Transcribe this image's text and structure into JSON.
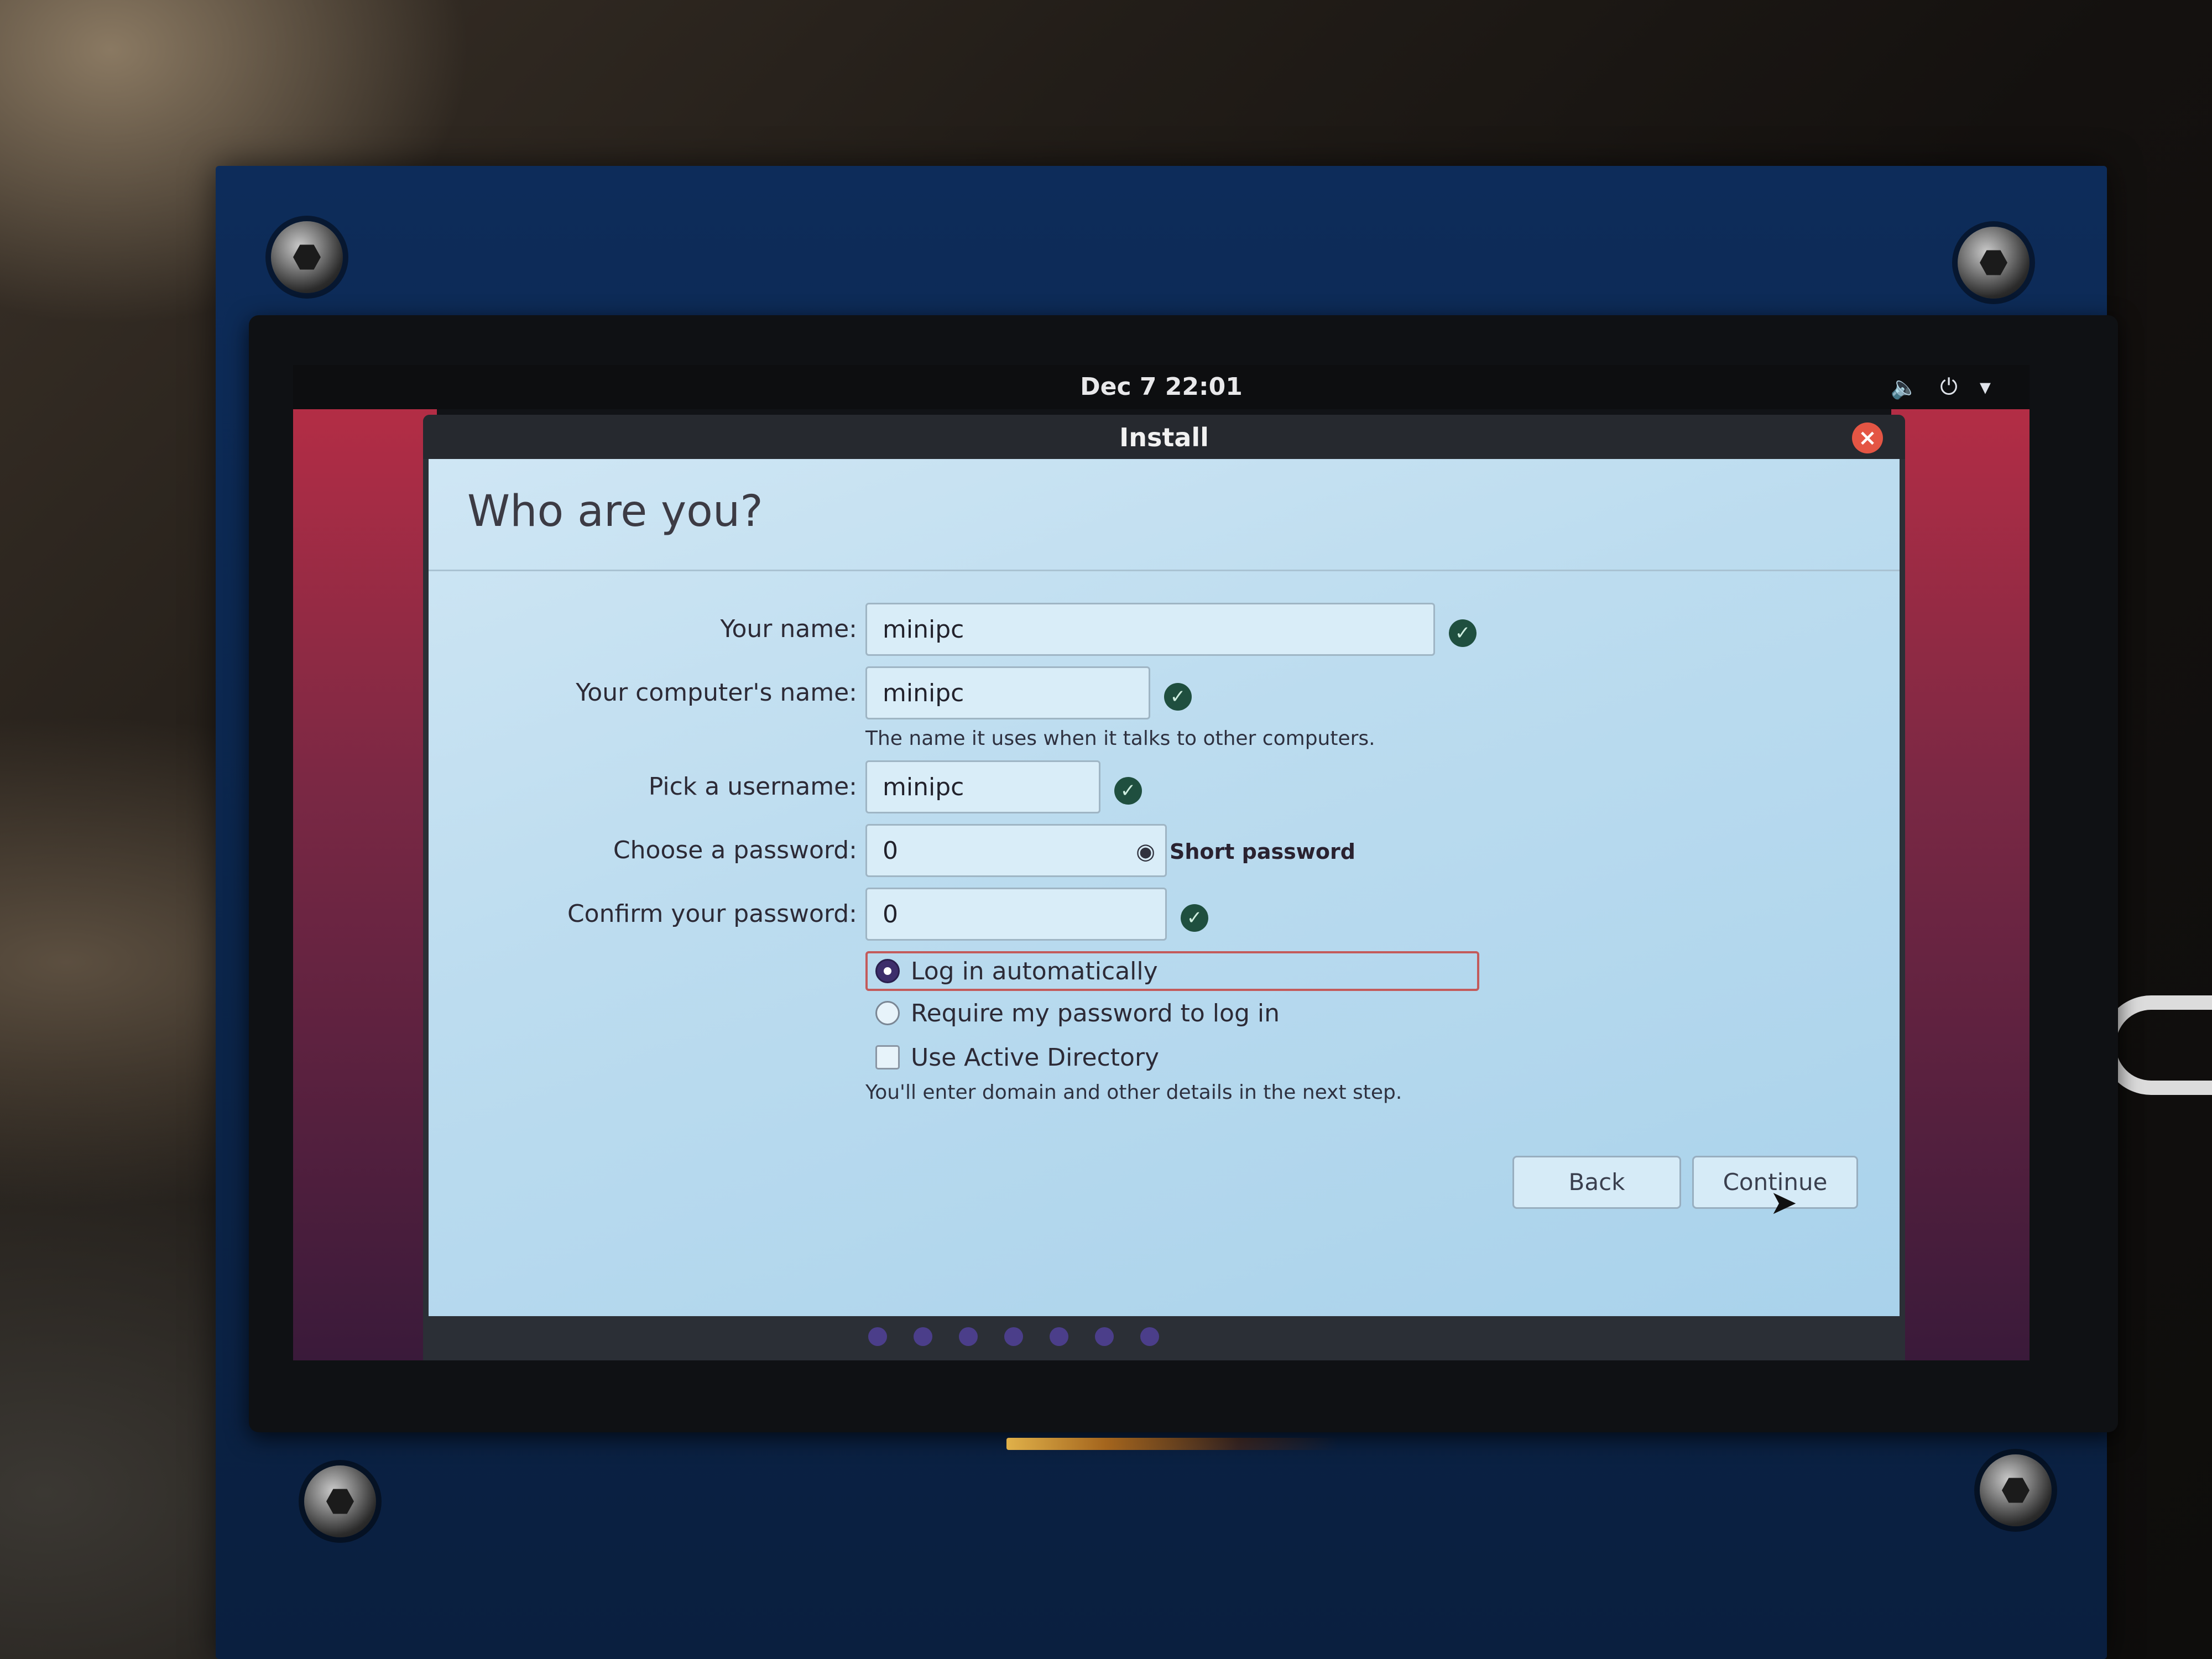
{
  "topbar": {
    "clock": "Dec 7  22:01",
    "icons": [
      "volume-icon",
      "power-icon",
      "chevron-down-icon"
    ]
  },
  "window": {
    "title": "Install",
    "close_icon": "close-icon"
  },
  "page": {
    "heading": "Who are you?"
  },
  "form": {
    "name": {
      "label": "Your name:",
      "value": "minipc"
    },
    "computer_name": {
      "label": "Your computer's name:",
      "value": "minipc",
      "hint": "The name it uses when it talks to other computers."
    },
    "username": {
      "label": "Pick a username:",
      "value": "minipc"
    },
    "password": {
      "label": "Choose a password:",
      "value": "0",
      "strength": "Short password"
    },
    "confirm_password": {
      "label": "Confirm your password:",
      "value": "0"
    },
    "login_options": [
      {
        "label": "Log in automatically",
        "selected": true
      },
      {
        "label": "Require my password to log in",
        "selected": false
      }
    ],
    "active_directory": {
      "label": "Use Active Directory",
      "checked": false,
      "hint": "You'll enter domain and other details in the next step."
    }
  },
  "buttons": {
    "back": "Back",
    "continue": "Continue"
  },
  "progress": {
    "steps_total": 7
  },
  "colors": {
    "accent": "#4b3e8a",
    "ok": "#1f4f3f",
    "selection_border": "#c35b5b",
    "close": "#e45544"
  }
}
